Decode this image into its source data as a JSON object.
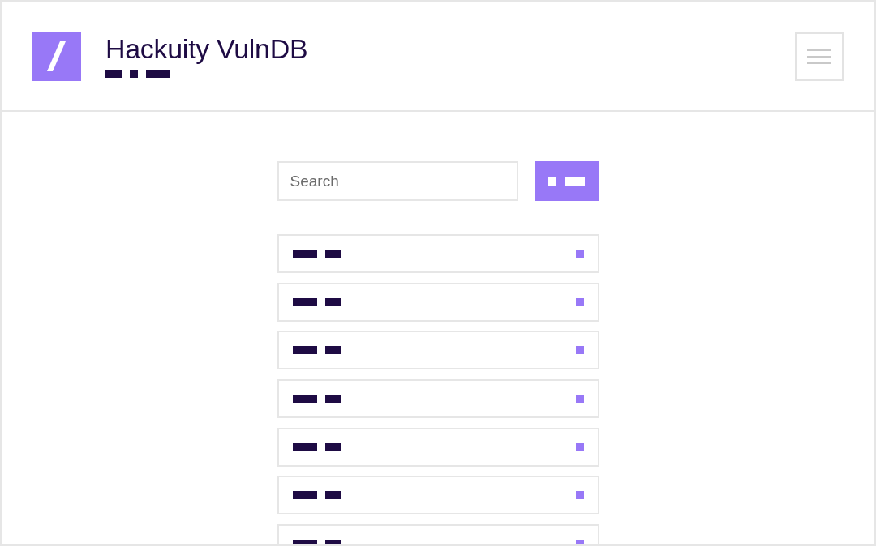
{
  "header": {
    "title": "Hackuity VulnDB"
  },
  "search": {
    "placeholder": "Search"
  },
  "results": [
    {
      "kind": "placeholder"
    },
    {
      "kind": "placeholder"
    },
    {
      "kind": "placeholder"
    },
    {
      "kind": "placeholder"
    },
    {
      "kind": "placeholder"
    },
    {
      "kind": "placeholder"
    },
    {
      "kind": "placeholder"
    }
  ]
}
